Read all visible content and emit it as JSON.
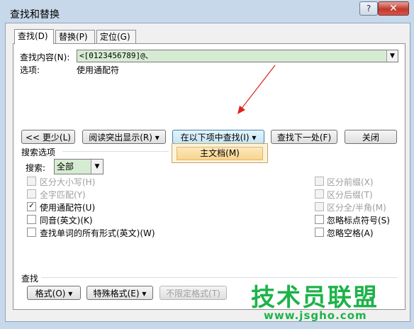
{
  "window": {
    "title": "查找和替换",
    "help_glyph": "?",
    "close_glyph": "✕"
  },
  "tabs": [
    {
      "label": "查找(D)",
      "active": true
    },
    {
      "label": "替换(P)",
      "active": false
    },
    {
      "label": "定位(G)",
      "active": false
    }
  ],
  "find": {
    "label": "查找内容(N):",
    "value": "<[0123456789]@、",
    "options_label": "选项:",
    "options_value": "使用通配符"
  },
  "buttons": {
    "less": "<< 更少(L)",
    "reading_highlight": "阅读突出显示(R) ▾",
    "find_in": "在以下项中查找(I) ▾",
    "find_next": "查找下一处(F)",
    "close": "关闭"
  },
  "find_in_menu": {
    "items": [
      "主文档(M)"
    ]
  },
  "search_options": {
    "heading": "搜索选项",
    "search_label": "搜索:",
    "search_value": "全部"
  },
  "checkboxes_left": [
    {
      "label": "区分大小写(H)",
      "checked": false,
      "disabled": true
    },
    {
      "label": "全字匹配(Y)",
      "checked": false,
      "disabled": true
    },
    {
      "label": "使用通配符(U)",
      "checked": true,
      "disabled": false
    },
    {
      "label": "同音(英文)(K)",
      "checked": false,
      "disabled": false
    },
    {
      "label": "查找单词的所有形式(英文)(W)",
      "checked": false,
      "disabled": false
    }
  ],
  "checkboxes_right": [
    {
      "label": "区分前缀(X)",
      "checked": false,
      "disabled": true
    },
    {
      "label": "区分后缀(T)",
      "checked": false,
      "disabled": true
    },
    {
      "label": "区分全/半角(M)",
      "checked": false,
      "disabled": true
    },
    {
      "label": "忽略标点符号(S)",
      "checked": false,
      "disabled": false
    },
    {
      "label": "忽略空格(A)",
      "checked": false,
      "disabled": false
    }
  ],
  "find_section": {
    "heading": "查找",
    "format": "格式(O) ▾",
    "special": "特殊格式(E) ▾",
    "no_format": "不限定格式(T)"
  },
  "watermark": {
    "text": "技术员联盟",
    "url": "www.jsgho.com"
  },
  "colors": {
    "accent_field": "#d6ecd2",
    "arrow": "#e0201b",
    "watermark": "#1db34a"
  }
}
